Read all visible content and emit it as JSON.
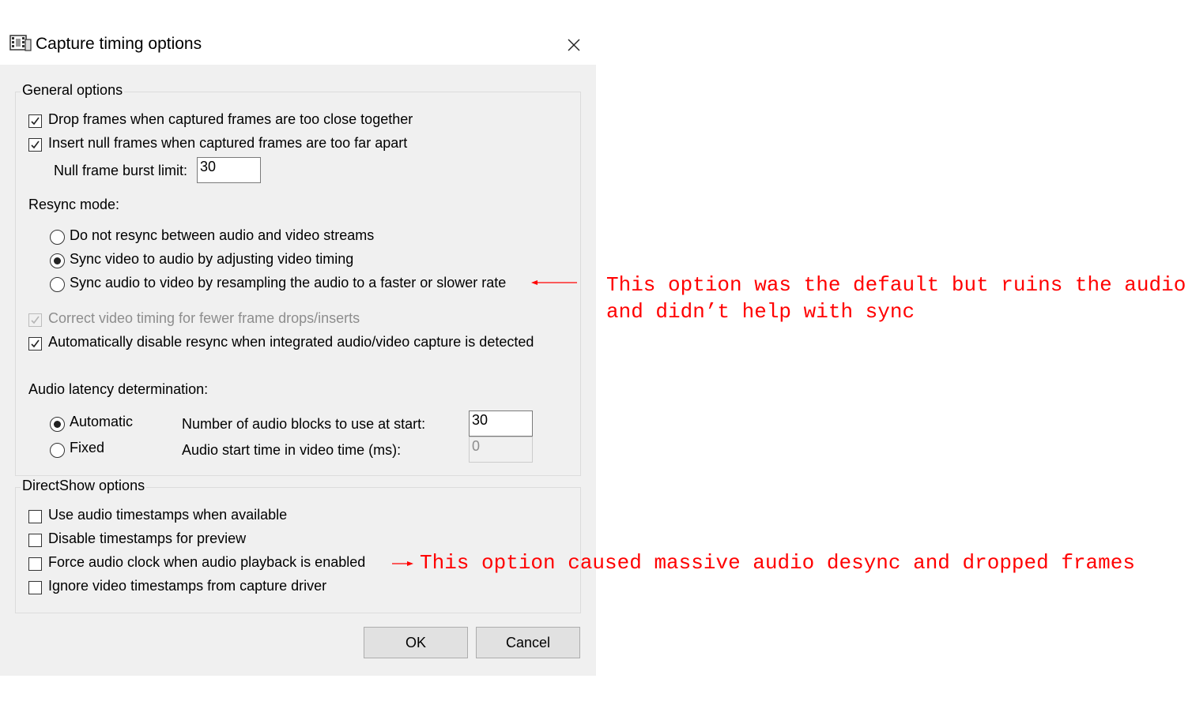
{
  "window": {
    "title": "Capture timing options",
    "icon": "film-capture-icon"
  },
  "general": {
    "title": "General options",
    "drop_frames": {
      "label": "Drop frames when captured frames are too close together",
      "checked": true
    },
    "insert_null": {
      "label": "Insert null frames when captured frames are too far apart",
      "checked": true
    },
    "null_burst": {
      "label": "Null frame burst limit:",
      "value": "30"
    },
    "resync_label": "Resync mode:",
    "resync_options": [
      {
        "label": "Do not resync between audio and video streams",
        "selected": false
      },
      {
        "label": "Sync video to audio by adjusting video timing",
        "selected": true
      },
      {
        "label": "Sync audio to video by resampling the audio to a faster or slower rate",
        "selected": false
      }
    ],
    "correct_timing": {
      "label": "Correct video timing for fewer frame drops/inserts",
      "checked": true,
      "disabled": true
    },
    "auto_disable": {
      "label": "Automatically disable resync when integrated audio/video capture is detected",
      "checked": true
    },
    "latency_label": "Audio latency determination:",
    "latency_modes": [
      {
        "label": "Automatic",
        "selected": true
      },
      {
        "label": "Fixed",
        "selected": false
      }
    ],
    "blocks": {
      "label": "Number of audio blocks to use at start:",
      "value": "30"
    },
    "start_time": {
      "label": "Audio start time in video time (ms):",
      "value": "0"
    }
  },
  "directshow": {
    "title": "DirectShow options",
    "options": [
      {
        "label": "Use audio timestamps when available",
        "checked": false
      },
      {
        "label": "Disable timestamps for preview",
        "checked": false
      },
      {
        "label": "Force audio clock when audio playback is enabled",
        "checked": false
      },
      {
        "label": "Ignore video timestamps from capture driver",
        "checked": false
      }
    ]
  },
  "buttons": {
    "ok": "OK",
    "cancel": "Cancel"
  },
  "annotations": {
    "resample": {
      "line1": "This option was the default but ruins the audio",
      "line2": "and didn’t help with sync"
    },
    "force_clock": "This option caused massive audio desync and dropped frames",
    "color": "#ff0000"
  }
}
